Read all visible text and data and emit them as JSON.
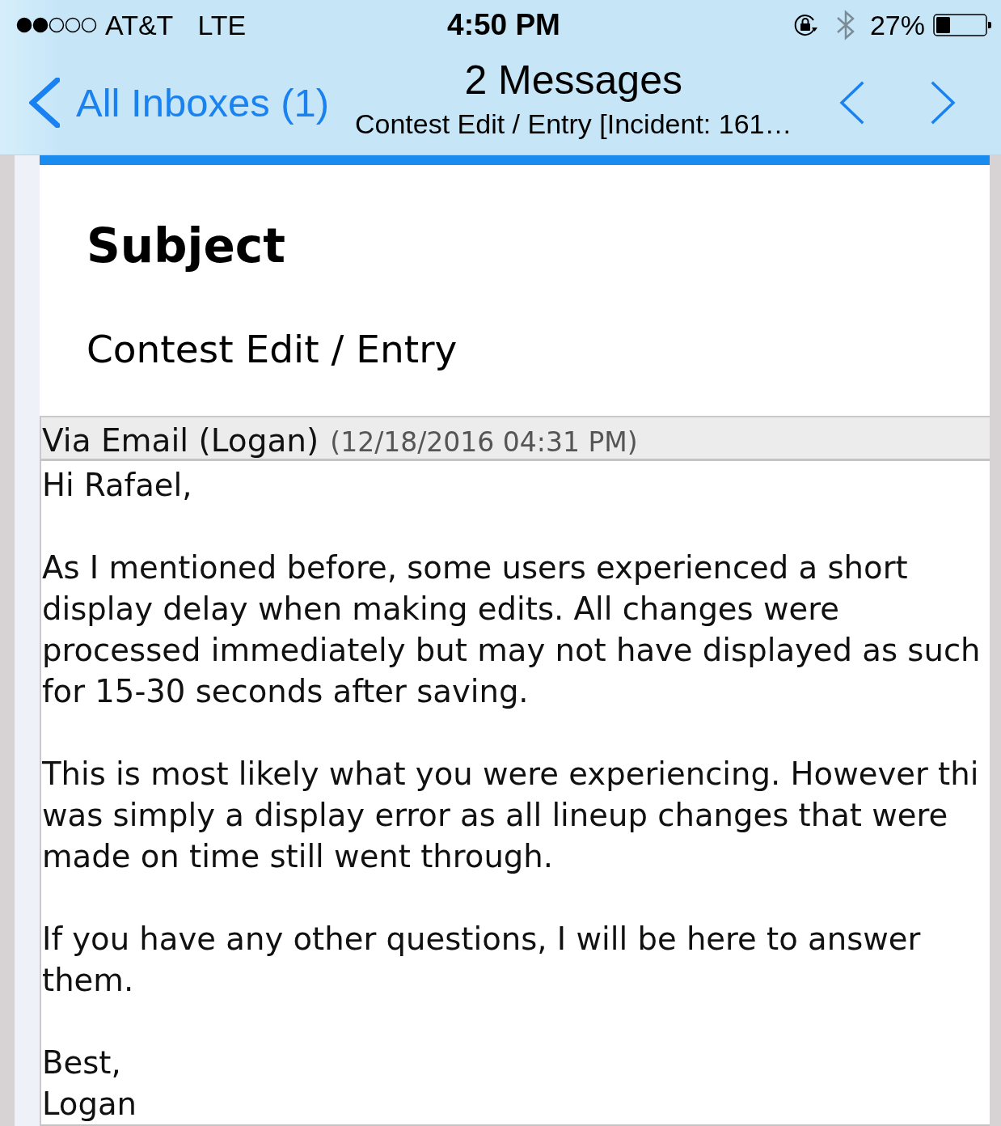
{
  "status_bar": {
    "carrier": "AT&T",
    "network": "LTE",
    "time": "4:50 PM",
    "battery": "27%"
  },
  "nav_bar": {
    "back_label": "All Inboxes (1)",
    "title": "2 Messages",
    "subtitle": "Contest Edit / Entry [Incident: 161…"
  },
  "subject": {
    "heading": "Subject",
    "value": "Contest Edit / Entry"
  },
  "message": {
    "sender": "Via Email (Logan)",
    "date": "(12/18/2016 04:31 PM)",
    "paragraphs": [
      [
        "Hi Rafael,"
      ],
      [
        "As I mentioned before, some users experienced a short",
        "display delay when making edits. All changes were",
        "processed immediately but may not have displayed as such",
        "for 15-30 seconds after saving."
      ],
      [
        "This is most likely what you were experiencing. However thi",
        "was simply a display error as all lineup changes that were",
        "made on time still went through."
      ],
      [
        "If you have any other questions, I will be here to answer",
        "them."
      ],
      [
        "Best,",
        "Logan"
      ]
    ]
  }
}
